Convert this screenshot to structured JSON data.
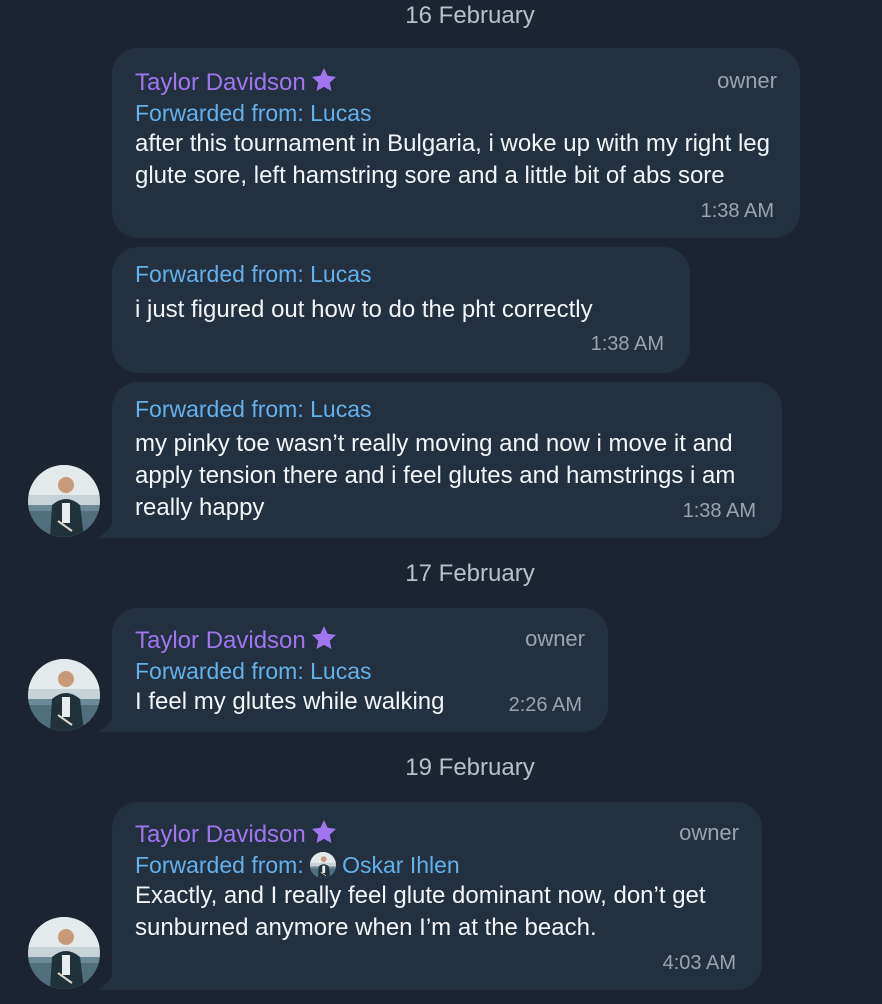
{
  "chat": {
    "dates": [
      "16 February",
      "17 February",
      "19 February"
    ],
    "messages": [
      {
        "sender": "Taylor Davidson",
        "role": "owner",
        "forwarded_label": "Forwarded from: ",
        "forwarded_name": "Lucas",
        "text": "after this tournament in Bulgaria, i woke up with my right leg glute sore, left hamstring sore and a little bit of abs sore",
        "time": "1:38 AM"
      },
      {
        "forwarded_label": "Forwarded from: ",
        "forwarded_name": "Lucas",
        "text": "i just figured out how to do the pht correctly",
        "time": "1:38 AM"
      },
      {
        "forwarded_label": "Forwarded from: ",
        "forwarded_name": "Lucas",
        "text": "my pinky toe wasn’t really moving and now i move it and apply tension there and i feel glutes and hamstrings i am really happy",
        "time": "1:38 AM"
      },
      {
        "sender": "Taylor Davidson",
        "role": "owner",
        "forwarded_label": "Forwarded from: ",
        "forwarded_name": "Lucas",
        "text": "I feel my glutes while walking",
        "time": "2:26 AM"
      },
      {
        "sender": "Taylor Davidson",
        "role": "owner",
        "forwarded_label": "Forwarded from: ",
        "forwarded_name": "Oskar Ihlen",
        "text": "Exactly, and I really feel glute dominant now, don’t get sunburned anymore when I’m at the beach.",
        "time": "4:03 AM"
      }
    ]
  },
  "colors": {
    "background": "#1c2331",
    "bubble": "#23303f",
    "sender": "#a076f0",
    "forwarded": "#63b1eb",
    "meta": "#9aa4af"
  },
  "icons": {
    "premium_badge": "star-icon",
    "avatar": "user-avatar"
  }
}
